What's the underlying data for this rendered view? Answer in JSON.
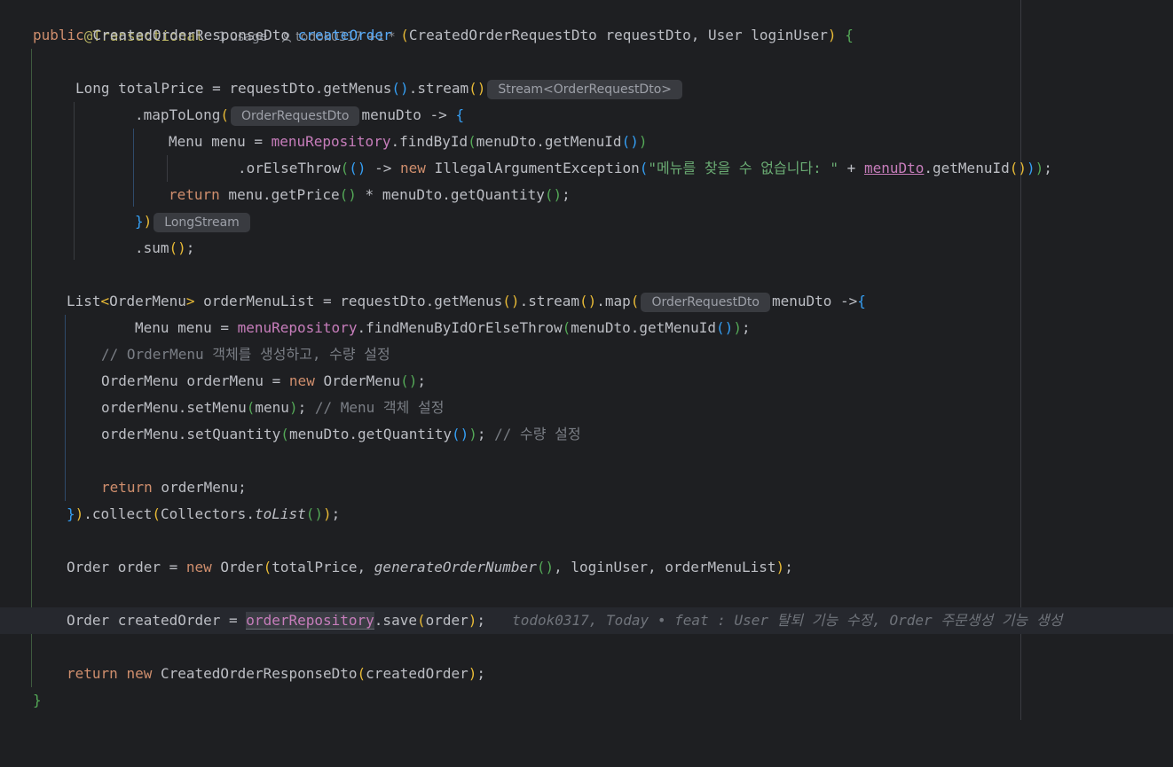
{
  "editor": {
    "header": {
      "annotation": "@Transactional",
      "usages": "1 usage",
      "author": "todok0317 +1 *"
    },
    "sig": {
      "public_kw": "public",
      "return_type": "CreatedOrderResponseDto",
      "method_name": "createOrder",
      "params": "CreatedOrderRequestDto requestDto, User loginUser"
    },
    "l4": {
      "a": "Long totalPrice = requestDto.getMenus",
      "b": ".stream",
      "hint": "Stream<OrderRequestDto>"
    },
    "l5": {
      "a": ".mapToLong",
      "hint": "OrderRequestDto",
      "b": "menuDto -> "
    },
    "l6": {
      "a": "Menu menu = ",
      "field": "menuRepository",
      "b": ".findById",
      "c": "menuDto.getMenuId"
    },
    "l7": {
      "a": ".orElseThrow",
      "b": " -> ",
      "new_kw": "new",
      "c": " IllegalArgumentException",
      "str": "\"메뉴를 찾을 수 없습니다: \"",
      "d": " + ",
      "field": "menuDto",
      "e": ".getMenuId"
    },
    "l8": {
      "return_kw": "return",
      "a": " menu.getPrice",
      "b": " * menuDto.getQuantity"
    },
    "l9": {
      "hint": "LongStream"
    },
    "l10": {
      "a": ".sum"
    },
    "l12": {
      "a": "List",
      "b": "OrderMenu",
      "c": " orderMenuList = requestDto.getMenus",
      "d": ".stream",
      "e": ".map",
      "hint": "OrderRequestDto",
      "f": "menuDto ->"
    },
    "l13": {
      "a": "Menu menu = ",
      "field": "menuRepository",
      "b": ".findMenuByIdOrElseThrow",
      "c": "menuDto.getMenuId"
    },
    "l14": {
      "comment": "// OrderMenu 객체를 생성하고, 수량 설정"
    },
    "l15": {
      "a": "OrderMenu orderMenu = ",
      "new_kw": "new",
      "b": " OrderMenu"
    },
    "l16": {
      "a": "orderMenu.setMenu",
      "b": "menu",
      "comment": "// Menu 객체 설정"
    },
    "l17": {
      "a": "orderMenu.setQuantity",
      "b": "menuDto.getQuantity",
      "comment": "// 수량 설정"
    },
    "l19": {
      "return_kw": "return",
      "a": " orderMenu;"
    },
    "l20": {
      "a": ".collect",
      "b": "Collectors.",
      "c": "toList"
    },
    "l22": {
      "a": "Order order = ",
      "new_kw": "new",
      "b": " Order",
      "c": "totalPrice, ",
      "d": "generateOrderNumber",
      "e": ", loginUser, orderMenuList"
    },
    "l24": {
      "a": "Order createdOrder = ",
      "field": "orderRepository",
      "b": ".save",
      "c": "order",
      "blame": "todok0317, Today • feat : User 탈퇴 기능 수정, Order 주문생성 기능 생성"
    },
    "l26": {
      "return_kw": "return",
      "new_kw": "new",
      "a": " CreatedOrderResponseDto",
      "b": "createdOrder"
    }
  },
  "colors": {
    "background": "#1e1f22",
    "keyword": "#cf8e6d",
    "method": "#56a8f5",
    "field": "#c77dbb",
    "string": "#6aab73",
    "comment": "#7a7e85",
    "annotation": "#b3ae60"
  }
}
